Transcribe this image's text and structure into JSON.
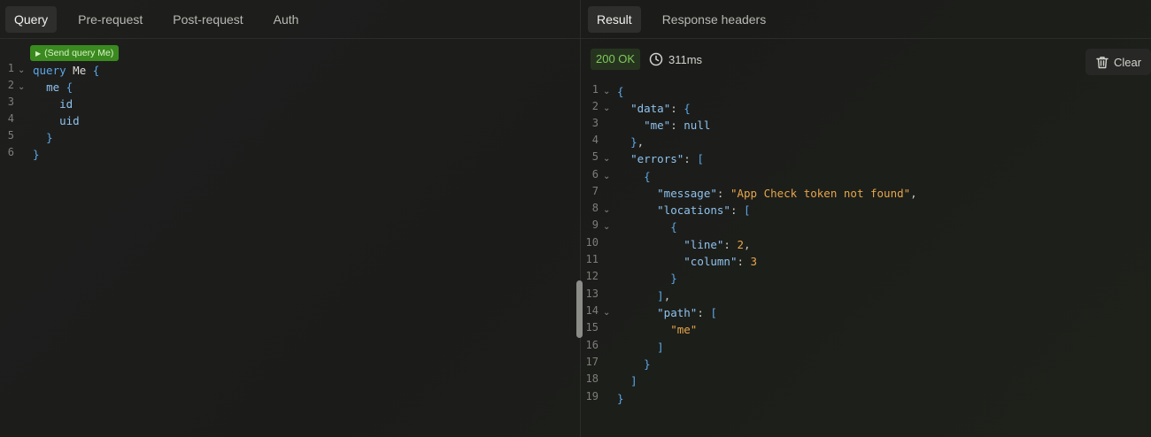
{
  "query_panel": {
    "tabs": [
      {
        "label": "Query",
        "active": true
      },
      {
        "label": "Pre-request",
        "active": false
      },
      {
        "label": "Post-request",
        "active": false
      },
      {
        "label": "Auth",
        "active": false
      }
    ],
    "run_button_label": "(Send query Me)",
    "editor": {
      "lines": [
        "1",
        "2",
        "3",
        "4",
        "5",
        "6"
      ],
      "q_keyword": "query",
      "q_name": "Me",
      "q_open": "{",
      "f_me": "me",
      "f_open": "{",
      "f_id": "id",
      "f_uid": "uid",
      "f_close": "}",
      "q_close": "}"
    }
  },
  "result_panel": {
    "tabs": [
      {
        "label": "Result",
        "active": true
      },
      {
        "label": "Response headers",
        "active": false
      }
    ],
    "status": "200 OK",
    "timing": "311ms",
    "clear_label": "Clear",
    "json": {
      "line_numbers": [
        "1",
        "2",
        "3",
        "4",
        "5",
        "6",
        "7",
        "8",
        "9",
        "10",
        "11",
        "12",
        "13",
        "14",
        "15",
        "16",
        "17",
        "18",
        "19"
      ],
      "data_key": "\"data\"",
      "me_key": "\"me\"",
      "null_value": "null",
      "errors_key": "\"errors\"",
      "message_key": "\"message\"",
      "message_value": "\"App Check token not found\"",
      "locations_key": "\"locations\"",
      "line_key": "\"line\"",
      "line_value": "2",
      "column_key": "\"column\"",
      "column_value": "3",
      "path_key": "\"path\"",
      "path_value": "\"me\""
    }
  },
  "colors": {
    "keyword": "#5ca7e6",
    "string": "#e6a64a",
    "status_ok": "#7fc95a",
    "run_button": "#3a8a1f"
  },
  "icons": [
    "play-icon",
    "clock-icon",
    "trash-icon",
    "chevron-down-icon"
  ]
}
